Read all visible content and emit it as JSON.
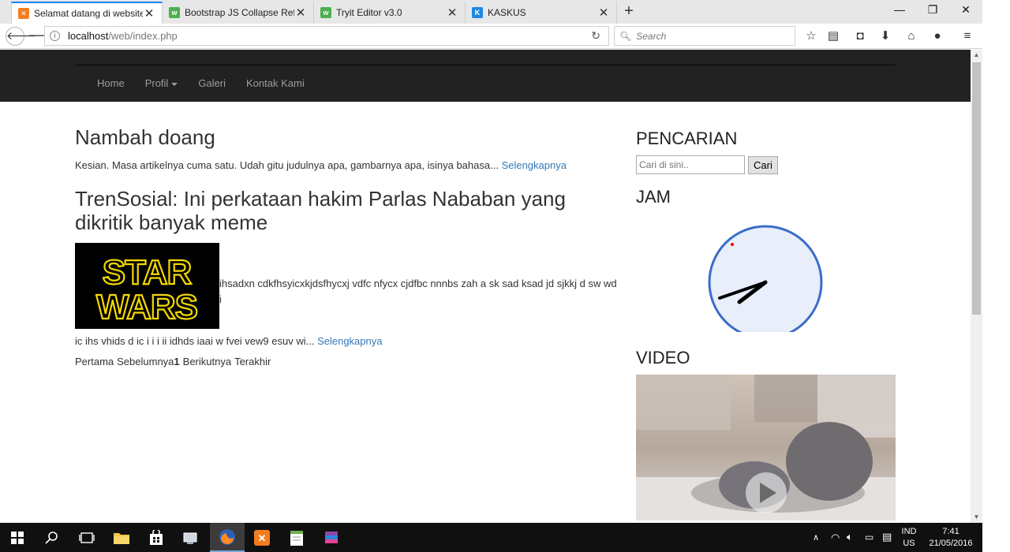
{
  "browser": {
    "tabs": [
      {
        "title": "Selamat datang di website...",
        "favicon": "xampp-icon",
        "color": "#f47d20",
        "active": true
      },
      {
        "title": "Bootstrap JS Collapse Refe...",
        "favicon": "w3schools-icon",
        "color": "#4caf50",
        "active": false
      },
      {
        "title": "Tryit Editor v3.0",
        "favicon": "w3schools-icon",
        "color": "#4caf50",
        "active": false
      },
      {
        "title": "KASKUS",
        "favicon": "kaskus-icon",
        "color": "#1e88e5",
        "active": false
      }
    ],
    "url_host": "localhost",
    "url_path": "/web/index.php",
    "search_placeholder": "Search"
  },
  "site": {
    "nav": [
      "Home",
      "Profil",
      "Galeri",
      "Kontak Kami"
    ],
    "posts": [
      {
        "title": "Nambah doang",
        "excerpt": "Kesian. Masa artikelnya cuma satu. Udah gitu judulnya apa, gambarnya apa, isinya bahasa...",
        "more": "Selengkapnya"
      },
      {
        "title": "TrenSosial: Ini perkataan hakim Parlas Nababan yang dikritik banyak meme",
        "image_text": [
          "STAR",
          "WARS"
        ],
        "excerpt_line1": "ihsadxn cdkfhsyicxkjdsfhycxj vdfc nfycx cjdfbc nnnbs zah a sk sad ksad jd sjkkj d sw wd i",
        "excerpt_line2": "ic ihs vhids d ic i i i ii idhds iaai w fvei vew9 esuv wi...",
        "more": "Selengkapnya"
      }
    ],
    "pager": {
      "first": "Pertama",
      "prev": "Sebelumnya",
      "current": "1",
      "next": "Berikutnya",
      "last": "Terakhir"
    },
    "sidebar": {
      "search_title": "PENCARIAN",
      "search_placeholder": "Cari di sini..",
      "search_button": "Cari",
      "clock_title": "JAM",
      "video_title": "VIDEO"
    }
  },
  "taskbar": {
    "lang1": "IND",
    "lang2": "US",
    "time": "7:41",
    "date": "21/05/2016"
  }
}
